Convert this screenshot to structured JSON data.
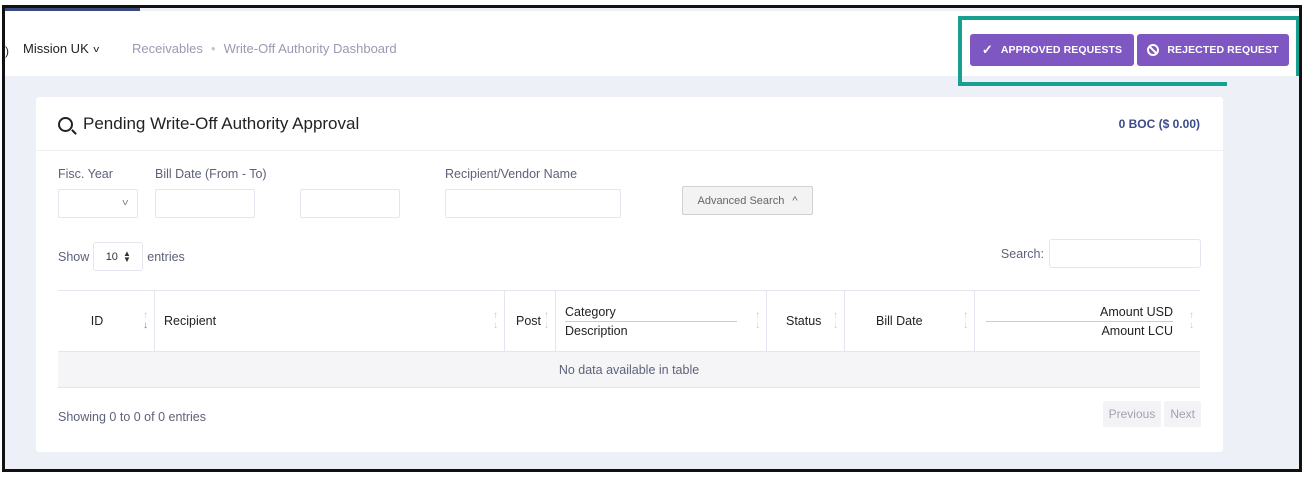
{
  "header": {
    "org_name": "Mission UK",
    "breadcrumbs": [
      "Receivables",
      "Write-Off Authority Dashboard"
    ]
  },
  "actions": {
    "approved_label": "APPROVED REQUESTS",
    "rejected_label": "REJECTED REQUEST",
    "accent_color": "#7e57c2",
    "highlight_color": "#17a090"
  },
  "card": {
    "title": "Pending Write-Off Authority Approval",
    "total": "0 BOC ($ 0.00)"
  },
  "filters": {
    "fiscal_year_label": "Fisc. Year",
    "fiscal_year_value": "",
    "bill_date_label": "Bill Date (From - To)",
    "recipient_label": "Recipient/Vendor Name",
    "advanced_search_label": "Advanced Search"
  },
  "table_controls": {
    "show_label": "Show",
    "entries_value": "10",
    "entries_label": "entries",
    "search_label": "Search:"
  },
  "table": {
    "columns": {
      "id": "ID",
      "recipient": "Recipient",
      "post": "Post",
      "category": "Category",
      "description": "Description",
      "status": "Status",
      "bill_date": "Bill Date",
      "amount_usd": "Amount USD",
      "amount_lcu": "Amount LCU"
    },
    "empty_message": "No data available in table"
  },
  "footer": {
    "info": "Showing 0 to 0 of 0 entries",
    "previous": "Previous",
    "next": "Next"
  }
}
